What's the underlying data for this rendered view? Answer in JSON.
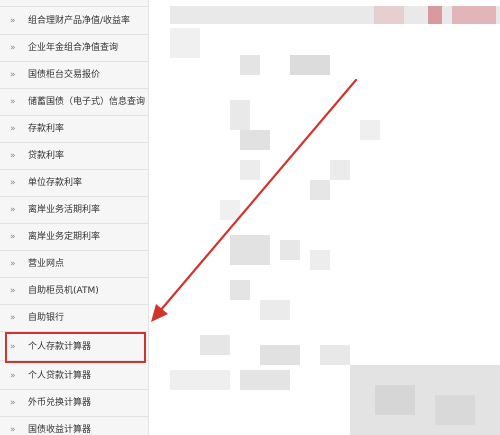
{
  "sidebar": {
    "items": [
      {
        "label": "组合理财产品净值/收益率"
      },
      {
        "label": "企业年金组合净值查询"
      },
      {
        "label": "国债柜台交易报价"
      },
      {
        "label": "储蓄国债（电子式）信息查询"
      },
      {
        "label": "存款利率"
      },
      {
        "label": "贷款利率"
      },
      {
        "label": "单位存款利率"
      },
      {
        "label": "离岸业务活期利率"
      },
      {
        "label": "离岸业务定期利率"
      },
      {
        "label": "营业网点"
      },
      {
        "label": "自助柜员机(ATM)"
      },
      {
        "label": "自助银行"
      },
      {
        "label": "个人存款计算器"
      },
      {
        "label": "个人贷款计算器"
      },
      {
        "label": "外币兑换计算器"
      },
      {
        "label": "国债收益计算器"
      }
    ],
    "chevron": "»"
  },
  "annotation": {
    "color": "#d0342c"
  }
}
